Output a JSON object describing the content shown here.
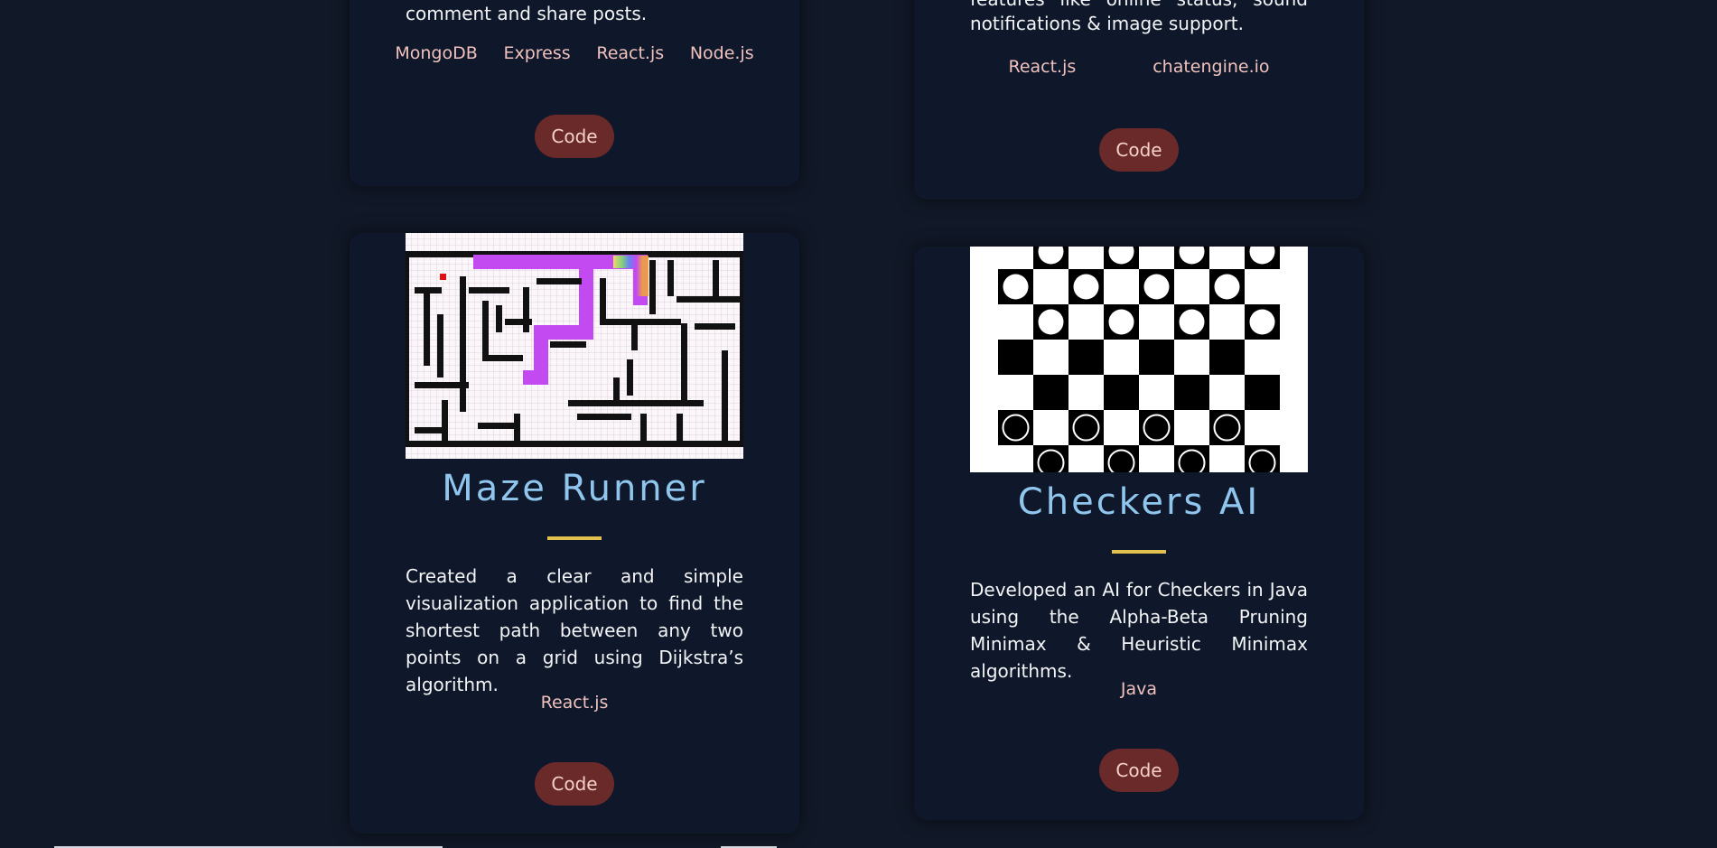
{
  "cards": [
    {
      "id": "top-left",
      "desc_tail": "comment and share posts.",
      "tags": [
        "MongoDB",
        "Express",
        "React.js",
        "Node.js"
      ],
      "code_label": "Code"
    },
    {
      "id": "top-right",
      "desc_tail_line1": "features like online status, sound",
      "desc_tail_line2": "notifications & image support.",
      "tags": [
        "React.js",
        "chatengine.io"
      ],
      "code_label": "Code"
    },
    {
      "id": "maze",
      "title": "Maze Runner",
      "image_alt": "maze-visualization",
      "description": "Created a clear and simple visualization application to find the shortest path between any two points on a grid using Dijkstra’s algorithm.",
      "tags": [
        "React.js"
      ],
      "code_label": "Code"
    },
    {
      "id": "checkers",
      "title": "Checkers AI",
      "image_alt": "checkers-board",
      "description": "Developed an AI for Checkers in Java using the Alpha-Beta Pruning Minimax & Heuristic Minimax algorithms.",
      "tags": [
        "Java"
      ],
      "code_label": "Code"
    }
  ],
  "colors": {
    "background": "#111827",
    "card": "#0f172a",
    "title": "#90c6ee",
    "accent_underline": "#e2c14e",
    "button": "#6b2a2a",
    "button_text": "#f5d0c8",
    "tag_text": "#f0c2bd"
  }
}
